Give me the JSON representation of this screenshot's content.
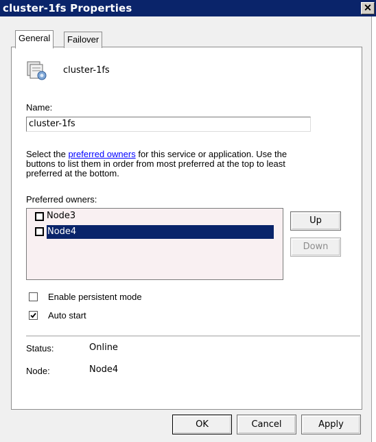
{
  "window": {
    "title": "cluster-1fs Properties",
    "close_glyph": "✕"
  },
  "tabs": [
    {
      "label": "General",
      "active": true
    },
    {
      "label": "Failover",
      "active": false
    }
  ],
  "general": {
    "resource_name": "cluster-1fs",
    "resource_icon": "clustered-service-icon",
    "name_label": "Name:",
    "name_value": "cluster-1fs",
    "description_prefix": "Select the ",
    "description_link": "preferred owners",
    "description_line1_suffix": " for this service or application. Use the",
    "description_line2": "buttons to list them in order from most preferred at the top to least",
    "description_line3": "preferred at the bottom.",
    "preferred_owners_label": "Preferred owners:",
    "owners": [
      {
        "name": "Node3",
        "checked": false,
        "selected": false
      },
      {
        "name": "Node4",
        "checked": false,
        "selected": true
      }
    ],
    "up_button": "Up",
    "down_button": "Down",
    "persistent_mode_label": "Enable persistent mode",
    "persistent_mode_checked": false,
    "auto_start_label": "Auto start",
    "auto_start_checked": true,
    "status_label": "Status:",
    "status_value": "Online",
    "node_label": "Node:",
    "node_value": "Node4"
  },
  "footer": {
    "ok_button": "OK",
    "cancel_button": "Cancel",
    "apply_button": "Apply"
  },
  "colors": {
    "titlebar": "#0a246a",
    "selection": "#0a246a",
    "link": "#0000ff",
    "listbox_bg": "#f9f0f2"
  }
}
